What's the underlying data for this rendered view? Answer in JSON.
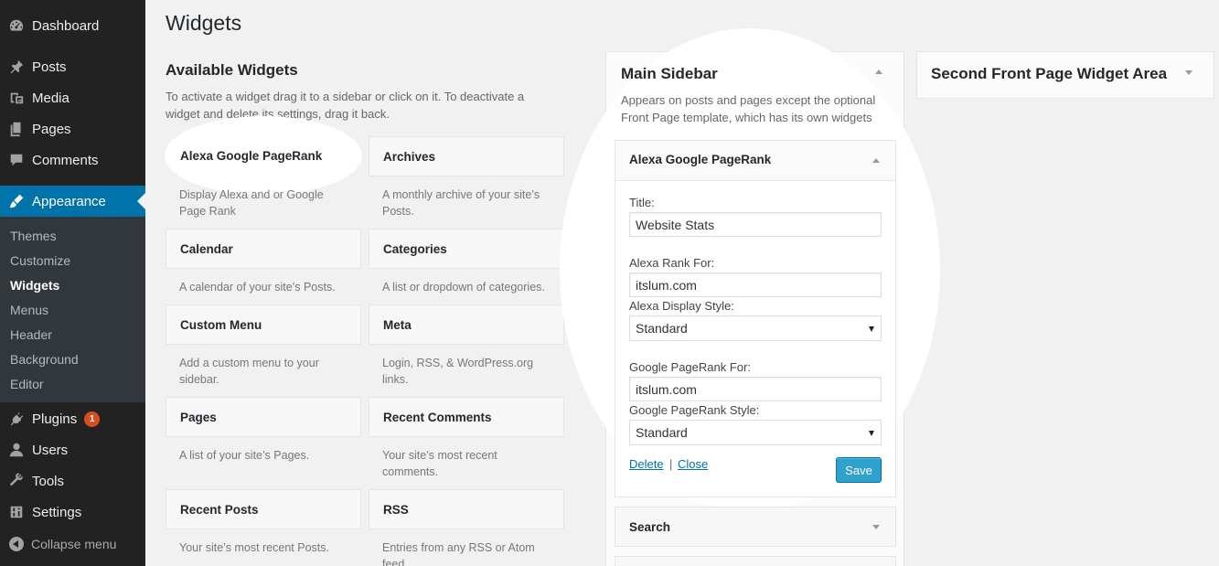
{
  "menu": {
    "items": [
      {
        "label": "Dashboard",
        "icon": "dashboard-icon"
      },
      {
        "label": "Posts",
        "icon": "pin-icon"
      },
      {
        "label": "Media",
        "icon": "media-icon"
      },
      {
        "label": "Pages",
        "icon": "pages-icon"
      },
      {
        "label": "Comments",
        "icon": "comment-icon"
      },
      {
        "label": "Appearance",
        "icon": "brush-icon"
      },
      {
        "label": "Plugins",
        "icon": "plugin-icon",
        "badge": "1"
      },
      {
        "label": "Users",
        "icon": "user-icon"
      },
      {
        "label": "Tools",
        "icon": "wrench-icon"
      },
      {
        "label": "Settings",
        "icon": "settings-icon"
      }
    ],
    "submenu": [
      "Themes",
      "Customize",
      "Widgets",
      "Menus",
      "Header",
      "Background",
      "Editor"
    ],
    "collapse_label": "Collapse menu"
  },
  "page": {
    "title": "Widgets"
  },
  "available": {
    "title": "Available Widgets",
    "description": "To activate a widget drag it to a sidebar or click on it. To deactivate a widget and delete its settings, drag it back.",
    "widgets": [
      {
        "name": "Alexa Google PageRank",
        "desc": "Display Alexa and or Google Page Rank"
      },
      {
        "name": "Archives",
        "desc": "A monthly archive of your site’s Posts."
      },
      {
        "name": "Calendar",
        "desc": "A calendar of your site’s Posts."
      },
      {
        "name": "Categories",
        "desc": "A list or dropdown of categories."
      },
      {
        "name": "Custom Menu",
        "desc": "Add a custom menu to your sidebar."
      },
      {
        "name": "Meta",
        "desc": "Login, RSS, & WordPress.org links."
      },
      {
        "name": "Pages",
        "desc": "A list of your site’s Pages."
      },
      {
        "name": "Recent Comments",
        "desc": "Your site’s most recent comments."
      },
      {
        "name": "Recent Posts",
        "desc": "Your site’s most recent Posts."
      },
      {
        "name": "RSS",
        "desc": "Entries from any RSS or Atom feed."
      }
    ]
  },
  "main_sidebar": {
    "title": "Main Sidebar",
    "description": "Appears on posts and pages except the optional Front Page template, which has its own widgets",
    "open_widget": {
      "title": "Alexa Google PageRank",
      "fields": {
        "title_label": "Title:",
        "title_value": "Website Stats",
        "alexa_for_label": "Alexa Rank For:",
        "alexa_for_value": "itslum.com",
        "alexa_style_label": "Alexa Display Style:",
        "alexa_style_value": "Standard",
        "google_for_label": "Google PageRank For:",
        "google_for_value": "itslum.com",
        "google_style_label": "Google PageRank Style:",
        "google_style_value": "Standard"
      },
      "delete_label": "Delete",
      "separator": "|",
      "close_label": "Close",
      "save_label": "Save"
    },
    "next_widget": "Search"
  },
  "second_area": {
    "title": "Second Front Page Widget Area"
  }
}
